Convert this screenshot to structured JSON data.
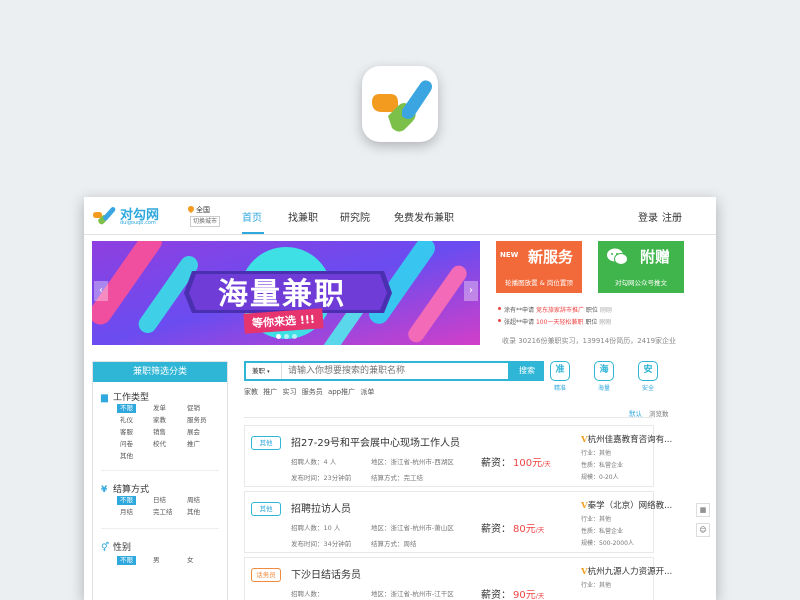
{
  "app_icon": {
    "name": "app-icon"
  },
  "header": {
    "logo_text": "对勾网",
    "logo_sub": "duigouqb.com",
    "location": {
      "city": "全国",
      "switch_label": "切换城市"
    },
    "nav": [
      {
        "label": "首页",
        "active": true
      },
      {
        "label": "找兼职",
        "active": false
      },
      {
        "label": "研究院",
        "active": false
      },
      {
        "label": "免费发布兼职",
        "active": false
      }
    ],
    "login": "登录",
    "register": "注册"
  },
  "banner": {
    "title": "海量兼职",
    "subtitle": "等你来选 !!!",
    "prev": "‹",
    "next": "›",
    "slide_count": 3,
    "active_slide": 1
  },
  "promos": [
    {
      "badge": "NEW",
      "title": "新服务",
      "desc": "轮播图放置 & 岗位置顶",
      "color": "#f26a3a"
    },
    {
      "badge": "",
      "title": "附赠",
      "desc": "对勾网公众号推文",
      "color": "#3fb54b"
    }
  ],
  "notices": [
    {
      "prefix": "涂有**申请",
      "highlight": "竞东旅家辞市推广",
      "suffix": "职位",
      "time": "刚刚"
    },
    {
      "prefix": "张超**申请",
      "highlight": "100一天轻松兼职",
      "suffix": "职位",
      "time": "刚刚"
    }
  ],
  "stats": "收录 30216份兼职实习，139914份简历，2419家企业",
  "filter": {
    "title": "兼职筛选分类",
    "groups": [
      {
        "name": "工作类型",
        "icon": "briefcase-icon",
        "options": [
          "不限",
          "发单",
          "促销",
          "礼仪",
          "家教",
          "服务员",
          "客服",
          "销售",
          "展会",
          "问卷",
          "校代",
          "推广",
          "其他"
        ],
        "selected": "不限"
      },
      {
        "name": "结算方式",
        "icon": "yen-icon",
        "options": [
          "不限",
          "日结",
          "周结",
          "月结",
          "完工结",
          "其他"
        ],
        "selected": "不限"
      },
      {
        "name": "性别",
        "icon": "gender-icon",
        "options": [
          "不限",
          "男",
          "女"
        ],
        "selected": "不限"
      }
    ]
  },
  "search": {
    "type": "兼职",
    "placeholder": "请输入你想要搜索的兼职名称",
    "button": "搜索",
    "hot_tags": [
      "家教",
      "推广",
      "实习",
      "服务员",
      "app推广",
      "派单"
    ]
  },
  "badges": [
    {
      "char": "准",
      "label": "精准"
    },
    {
      "char": "海",
      "label": "海量"
    },
    {
      "char": "安",
      "label": "安全"
    }
  ],
  "sort": {
    "default": "默认",
    "by_views": "浏览数"
  },
  "jobs": [
    {
      "tag": "其他",
      "tag_color": "blue",
      "title": "招27-29号和平会展中心现场工作人员",
      "recruits": "招聘人数：4 人",
      "area": "地区：浙江省-杭州市-西湖区",
      "posted": "发布时间：23分钟前",
      "settle": "结算方式：完工结",
      "salary_label": "薪资：",
      "salary": "100元",
      "unit": "/天",
      "company": "杭州佳嘉教育咨询有...",
      "industry": "行业：其他",
      "nature": "性质：私营企业",
      "size": "规模：0-20人"
    },
    {
      "tag": "其他",
      "tag_color": "blue",
      "title": "招聘拉访人员",
      "recruits": "招聘人数：10 人",
      "area": "地区：浙江省-杭州市-萧山区",
      "posted": "发布时间：34分钟前",
      "settle": "结算方式：周结",
      "salary_label": "薪资：",
      "salary": "80元",
      "unit": "/天",
      "company": "秦学（北京）网络教...",
      "industry": "行业：其他",
      "nature": "性质：私营企业",
      "size": "规模：500-2000人"
    },
    {
      "tag": "话务员",
      "tag_color": "orange",
      "title": "下沙日结话务员",
      "recruits": "招聘人数：",
      "area": "地区：浙江省-杭州市-江干区",
      "posted": "",
      "settle": "",
      "salary_label": "薪资：",
      "salary": "90元",
      "unit": "/天",
      "company": "杭州九源人力资源开...",
      "industry": "行业：其他",
      "nature": "",
      "size": ""
    }
  ],
  "side_tools": [
    "qr-code-icon",
    "qq-chat-icon"
  ],
  "colors": {
    "accent": "#2fb6d6",
    "salary": "#e44444",
    "promo_orange": "#f26a3a",
    "promo_green": "#3fb54b",
    "company_v": "#f0a020"
  }
}
